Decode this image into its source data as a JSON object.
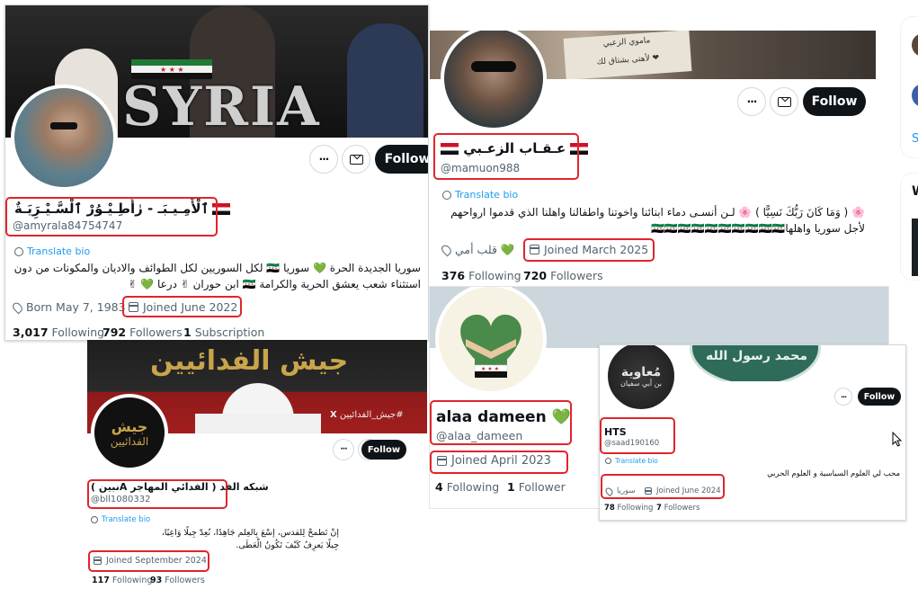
{
  "ui": {
    "follow_label": "Follow",
    "more_glyph": "···",
    "translate_label": "Translate bio"
  },
  "colors": {
    "highlight": "#e0252b",
    "link": "#1d9bf0",
    "follow_bg": "#0f1419",
    "muted": "#536471",
    "green_heart": "#78b159"
  },
  "card1": {
    "banner_text": "SYRIA",
    "name": "ٱلْأَمِـيـبَـ - رٰأَطِـيْـوُرْ ٱلْسَّـيْـرَِيَـةٌ",
    "handle": "@amyrala84754747",
    "bio_line1": "سوريا الجديدة الحرة 💚 سوريا 🇸🇾 لكل السوريين لكل الطوائف والاديان والمكونات من دون",
    "bio_line2": "استثناء شعب يعشق الحرية والكرامة 🇸🇾 ابن حوران ✌ درعا 💚 ✌",
    "born": "Born May 7, 1983",
    "joined": "Joined June 2022",
    "following_count": "3,017",
    "following_label": "Following",
    "followers_count": "792",
    "followers_label": "Followers",
    "subs_count": "1",
    "subs_label": "Subscription"
  },
  "card2": {
    "banner_note_line1": "ماموي الزعبي",
    "banner_note_line2": "لأهتى بشتاق لك ❤",
    "name": "عـقـاب الزعـبي",
    "handle": "@mamuon988",
    "bio_line1": "🌸 ( وَمَا كَانَ رَبُّكَ نَسِيًّا ) 🌸 لـن أنسـى دماء ابنائنا واخوتنا واطفالنا واهلنا الذي قدموا ارواحهم",
    "bio_line2": "لأجل سوريا واهلها🇸🇾🇸🇾🇸🇾🇸🇾🇸🇾🇸🇾🇸🇾🇸🇾🇸🇾🇸🇾",
    "location": "قلب أمي 💚",
    "joined": "Joined March 2025",
    "following_count": "376",
    "following_label": "Following",
    "followers_count": "720",
    "followers_label": "Followers"
  },
  "card3": {
    "banner_title": "جيش الفدائيين",
    "banner_tag": "#جيش_الفدائيين",
    "banner_x": "X",
    "avatar_text_line1": "جيش",
    "avatar_text_line2": "الفدائيين",
    "name": "( نبينA شبكه الفد ( الفدائي المهاجر",
    "handle": "@bll1080332",
    "bio_line1": "إنْ تَطمحْ لِلقدس، إسْعَ بِالعِلم جَاهِدًا، نُعِدّ جِيلًا وَاعِيًا،",
    "bio_line2": "جِيلًا يَعرِفُ كَيْفَ تَكُونُ الْعَطَى.",
    "joined": "Joined September 2024",
    "following_count": "117",
    "following_label": "Following",
    "followers_count": "93",
    "followers_label": "Followers"
  },
  "card4": {
    "name": "alaa dameen 💚",
    "handle": "@alaa_dameen",
    "joined": "Joined April 2023",
    "following_count": "4",
    "following_label": "Following",
    "followers_count": "1",
    "followers_label": "Follower"
  },
  "card5": {
    "banner_text": "محمد رسول الله",
    "avatar_text_line1": "مُعاوية",
    "avatar_text_line2": "بن أبي سفيان",
    "name": "HTS",
    "handle": "@saad190160",
    "bio": "محب لي العلوم السياسية و العلوم الحربي",
    "location": "سوريا",
    "joined": "Joined June 2024",
    "following_count": "78",
    "following_label": "Following",
    "followers_count": "7",
    "followers_label": "Followers"
  },
  "sidebar": {
    "link_letter": "S",
    "heading_letter": "W"
  }
}
